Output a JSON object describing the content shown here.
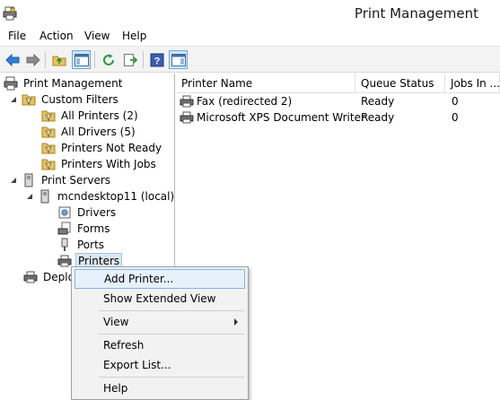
{
  "window": {
    "title": "Print Management",
    "icon": "printer-app-icon"
  },
  "menu": [
    "File",
    "Action",
    "View",
    "Help"
  ],
  "toolbar": {
    "buttons": [
      "back-arrow-icon",
      "forward-arrow-icon",
      "up-folder-icon",
      "show-hide-tree-icon",
      "refresh-icon",
      "export-list-icon",
      "help-icon",
      "show-action-pane-icon"
    ]
  },
  "tree": {
    "root": "Print Management",
    "custom_filters": "Custom Filters",
    "all_printers": "All Printers (2)",
    "all_drivers": "All Drivers (5)",
    "printers_not_ready": "Printers Not Ready",
    "printers_with_jobs": "Printers With Jobs",
    "print_servers": "Print Servers",
    "server": "mcndesktop11 (local)",
    "drivers": "Drivers",
    "forms": "Forms",
    "ports": "Ports",
    "printers": "Printers",
    "deployed": "Deploy"
  },
  "list": {
    "columns": [
      "Printer Name",
      "Queue Status",
      "Jobs In ..."
    ],
    "rows": [
      {
        "name": "Fax (redirected 2)",
        "status": "Ready",
        "jobs": "0"
      },
      {
        "name": "Microsoft XPS Document Writer",
        "status": "Ready",
        "jobs": "0"
      }
    ]
  },
  "context_menu": {
    "add_printer": "Add Printer...",
    "show_extended": "Show Extended View",
    "view": "View",
    "refresh": "Refresh",
    "export": "Export List...",
    "help": "Help"
  },
  "colors": {
    "selection": "#dbe8f5",
    "menu_hover": "#e5f1fb",
    "menu_hover_border": "#7fb4e3"
  }
}
